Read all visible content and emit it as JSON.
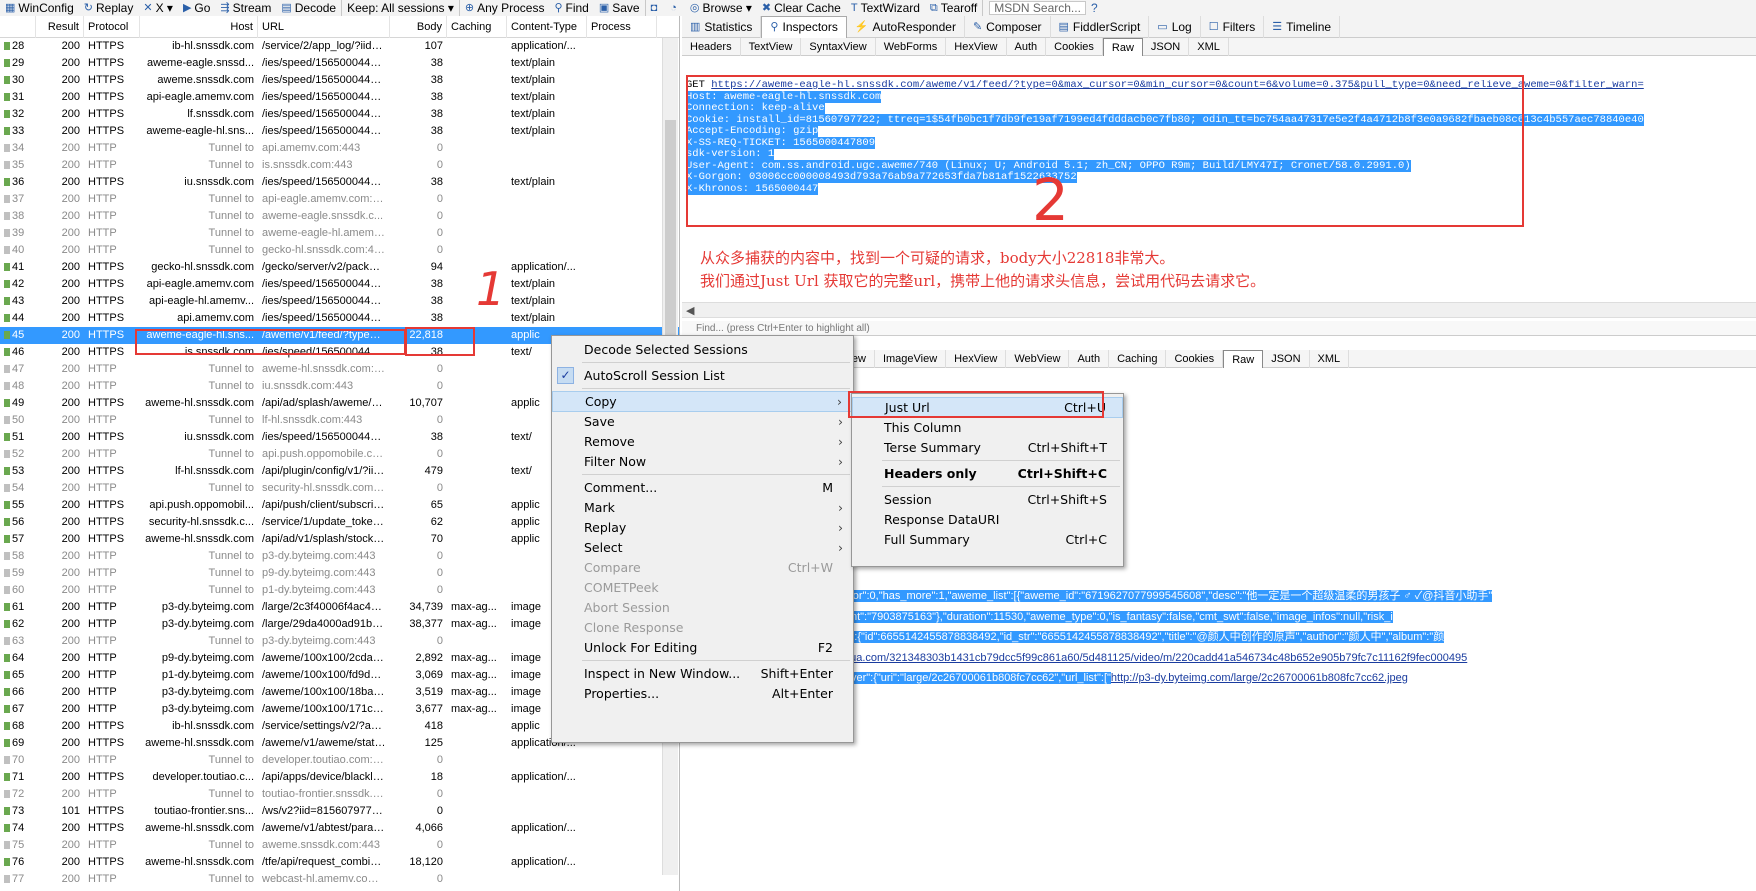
{
  "toolbar": {
    "items": [
      {
        "label": "WinConfig",
        "icon": "windows-icon"
      },
      {
        "label": "Replay",
        "icon": "replay-icon"
      },
      {
        "label": "X ▾",
        "icon": "remove-icon"
      },
      {
        "label": "Go",
        "icon": "go-arrow-icon"
      },
      {
        "label": "Stream",
        "icon": "stream-icon"
      },
      {
        "label": "Decode",
        "icon": "decode-icon"
      },
      {
        "label": "Keep: All sessions ▾",
        "icon": ""
      },
      {
        "label": "Any Process",
        "icon": "crosshair-icon"
      },
      {
        "label": "Find",
        "icon": "binoculars-icon"
      },
      {
        "label": "Save",
        "icon": "save-icon"
      },
      {
        "label": "",
        "icon": "camera-icon"
      },
      {
        "label": "",
        "icon": "timer-icon"
      },
      {
        "label": "Browse ▾",
        "icon": "browse-icon"
      },
      {
        "label": "Clear Cache",
        "icon": "clear-cache-icon"
      },
      {
        "label": "TextWizard",
        "icon": "textwizard-icon"
      },
      {
        "label": "Tearoff",
        "icon": "tearoff-icon"
      }
    ],
    "search_placeholder": "MSDN Search...",
    "help_icon": "help-icon"
  },
  "sessions": {
    "columns": [
      "",
      "Result",
      "Protocol",
      "Host",
      "URL",
      "Body",
      "Caching",
      "Content-Type",
      "Process"
    ],
    "rows": [
      [
        "28",
        "200",
        "HTTPS",
        "ib-hl.snssdk.com",
        "/service/2/app_log/?iid=8...",
        "107",
        "",
        "application/...",
        "",
        false,
        false
      ],
      [
        "29",
        "200",
        "HTTPS",
        "aweme-eagle.snssd...",
        "/ies/speed/1565000447552",
        "38",
        "",
        "text/plain",
        "",
        false,
        false
      ],
      [
        "30",
        "200",
        "HTTPS",
        "aweme.snssdk.com",
        "/ies/speed/1565000447563",
        "38",
        "",
        "text/plain",
        "",
        false,
        false
      ],
      [
        "31",
        "200",
        "HTTPS",
        "api-eagle.amemv.com",
        "/ies/speed/1565000447271",
        "38",
        "",
        "text/plain",
        "",
        false,
        false
      ],
      [
        "32",
        "200",
        "HTTPS",
        "lf.snssdk.com",
        "/ies/speed/1565000447564",
        "38",
        "",
        "text/plain",
        "",
        false,
        false
      ],
      [
        "33",
        "200",
        "HTTPS",
        "aweme-eagle-hl.sns...",
        "/ies/speed/1565000447554",
        "38",
        "",
        "text/plain",
        "",
        false,
        false
      ],
      [
        "34",
        "200",
        "HTTP",
        "Tunnel to",
        "api.amemv.com:443",
        "0",
        "",
        "",
        "",
        true,
        false
      ],
      [
        "35",
        "200",
        "HTTP",
        "Tunnel to",
        "is.snssdk.com:443",
        "0",
        "",
        "",
        "",
        true,
        false
      ],
      [
        "36",
        "200",
        "HTTPS",
        "iu.snssdk.com",
        "/ies/speed/1565000447599",
        "38",
        "",
        "text/plain",
        "",
        false,
        false
      ],
      [
        "37",
        "200",
        "HTTP",
        "Tunnel to",
        "api-eagle.amemv.com:443",
        "0",
        "",
        "",
        "",
        true,
        false
      ],
      [
        "38",
        "200",
        "HTTP",
        "Tunnel to",
        "aweme-eagle.snssdk.c...",
        "0",
        "",
        "",
        "",
        true,
        false
      ],
      [
        "39",
        "200",
        "HTTP",
        "Tunnel to",
        "aweme-eagle-hl.amemv.com:...",
        "0",
        "",
        "",
        "",
        true,
        false
      ],
      [
        "40",
        "200",
        "HTTP",
        "Tunnel to",
        "gecko-hl.snssdk.com:443",
        "0",
        "",
        "",
        "",
        true,
        false
      ],
      [
        "41",
        "200",
        "HTTPS",
        "gecko-hl.snssdk.com",
        "/gecko/server/v2/packag...",
        "94",
        "",
        "application/...",
        "",
        false,
        false
      ],
      [
        "42",
        "200",
        "HTTPS",
        "api-eagle.amemv.com",
        "/ies/speed/1565000447868",
        "38",
        "",
        "text/plain",
        "",
        false,
        false
      ],
      [
        "43",
        "200",
        "HTTPS",
        "api-eagle-hl.amemv...",
        "/ies/speed/1565000447891",
        "38",
        "",
        "text/plain",
        "",
        false,
        false
      ],
      [
        "44",
        "200",
        "HTTPS",
        "api.amemv.com",
        "/ies/speed/1565000447838",
        "38",
        "",
        "text/plain",
        "",
        false,
        false
      ],
      [
        "45",
        "200",
        "HTTPS",
        "aweme-eagle-hl.sns...",
        "/aweme/v1/feed/?type=0...",
        "22,818",
        "",
        "applic",
        "",
        false,
        true
      ],
      [
        "46",
        "200",
        "HTTPS",
        "is.snssdk.com",
        "/ies/speed/1565000447841",
        "38",
        "",
        "text/",
        "",
        false,
        false
      ],
      [
        "47",
        "200",
        "HTTP",
        "Tunnel to",
        "aweme-hl.snssdk.com:443",
        "0",
        "",
        "",
        "",
        true,
        false
      ],
      [
        "48",
        "200",
        "HTTP",
        "Tunnel to",
        "iu.snssdk.com:443",
        "0",
        "",
        "",
        "",
        true,
        false
      ],
      [
        "49",
        "200",
        "HTTPS",
        "aweme-hl.snssdk.com",
        "/api/ad/splash/aweme/v1...",
        "10,707",
        "",
        "applic",
        "",
        false,
        false
      ],
      [
        "50",
        "200",
        "HTTP",
        "Tunnel to",
        "lf-hl.snssdk.com:443",
        "0",
        "",
        "",
        "",
        true,
        false
      ],
      [
        "51",
        "200",
        "HTTPS",
        "iu.snssdk.com",
        "/ies/speed/1565000448102",
        "38",
        "",
        "text/",
        "",
        false,
        false
      ],
      [
        "52",
        "200",
        "HTTP",
        "Tunnel to",
        "api.push.oppomobile.com:...",
        "0",
        "",
        "",
        "",
        true,
        false
      ],
      [
        "53",
        "200",
        "HTTPS",
        "lf-hl.snssdk.com",
        "/api/plugin/config/v1/?iid=...",
        "479",
        "",
        "text/",
        "",
        false,
        false
      ],
      [
        "54",
        "200",
        "HTTP",
        "Tunnel to",
        "security-hl.snssdk.com:443",
        "0",
        "",
        "",
        "",
        true,
        false
      ],
      [
        "55",
        "200",
        "HTTPS",
        "api.push.oppomobil...",
        "/api/push/client/subscribe...",
        "65",
        "",
        "applic",
        "",
        false,
        false
      ],
      [
        "56",
        "200",
        "HTTPS",
        "security-hl.snssdk.c...",
        "/service/1/update_token/...",
        "62",
        "",
        "applic",
        "",
        false,
        false
      ],
      [
        "57",
        "200",
        "HTTPS",
        "aweme-hl.snssdk.com",
        "/api/ad/v1/splash/stock/?...",
        "70",
        "",
        "applic",
        "",
        false,
        false
      ],
      [
        "58",
        "200",
        "HTTP",
        "Tunnel to",
        "p3-dy.byteimg.com:443",
        "0",
        "",
        "",
        "",
        true,
        false
      ],
      [
        "59",
        "200",
        "HTTP",
        "Tunnel to",
        "p9-dy.byteimg.com:443",
        "0",
        "",
        "",
        "",
        true,
        false
      ],
      [
        "60",
        "200",
        "HTTP",
        "Tunnel to",
        "p1-dy.byteimg.com:443",
        "0",
        "",
        "",
        "",
        true,
        false
      ],
      [
        "61",
        "200",
        "HTTP",
        "p3-dy.byteimg.com",
        "/large/2c3f40006f4ac495...",
        "34,739",
        "max-ag...",
        "image",
        "",
        false,
        false
      ],
      [
        "62",
        "200",
        "HTTP",
        "p3-dy.byteimg.com",
        "/large/29da4000ad91b42...",
        "38,377",
        "max-ag...",
        "image",
        "",
        false,
        false
      ],
      [
        "63",
        "200",
        "HTTP",
        "Tunnel to",
        "p3-dy.byteimg.com:443",
        "0",
        "",
        "",
        "",
        true,
        false
      ],
      [
        "64",
        "200",
        "HTTP",
        "p9-dy.byteimg.com",
        "/aweme/100x100/2cdae0...",
        "2,892",
        "max-ag...",
        "image",
        "",
        false,
        false
      ],
      [
        "65",
        "200",
        "HTTP",
        "p1-dy.byteimg.com",
        "/aweme/100x100/fd9d00...",
        "3,069",
        "max-ag...",
        "image",
        "",
        false,
        false
      ],
      [
        "66",
        "200",
        "HTTP",
        "p3-dy.byteimg.com",
        "/aweme/100x100/18baf0...",
        "3,519",
        "max-ag...",
        "image",
        "",
        false,
        false
      ],
      [
        "67",
        "200",
        "HTTP",
        "p3-dy.byteimg.com",
        "/aweme/100x100/171c30...",
        "3,677",
        "max-ag...",
        "image",
        "",
        false,
        false
      ],
      [
        "68",
        "200",
        "HTTPS",
        "ib-hl.snssdk.com",
        "/service/settings/v2/?app...",
        "418",
        "",
        "applic",
        "",
        false,
        false
      ],
      [
        "69",
        "200",
        "HTTPS",
        "aweme-hl.snssdk.com",
        "/aweme/v1/aweme/stats/...",
        "125",
        "",
        "application/...",
        "",
        false,
        false
      ],
      [
        "70",
        "200",
        "HTTP",
        "Tunnel to",
        "developer.toutiao.com:443",
        "0",
        "",
        "",
        "",
        true,
        false
      ],
      [
        "71",
        "200",
        "HTTPS",
        "developer.toutiao.c...",
        "/api/apps/device/blacklist?...",
        "18",
        "",
        "application/...",
        "",
        false,
        false
      ],
      [
        "72",
        "200",
        "HTTP",
        "Tunnel to",
        "toutiao-frontier.snssdk.co...",
        "0",
        "",
        "",
        "",
        true,
        false
      ],
      [
        "73",
        "101",
        "HTTPS",
        "toutiao-frontier.sns...",
        "/ws/v2?iid=81560797722...",
        "0",
        "",
        "",
        "",
        false,
        false
      ],
      [
        "74",
        "200",
        "HTTPS",
        "aweme-hl.snssdk.com",
        "/aweme/v1/abtest/param...",
        "4,066",
        "",
        "application/...",
        "",
        false,
        false
      ],
      [
        "75",
        "200",
        "HTTP",
        "Tunnel to",
        "aweme.snssdk.com:443",
        "0",
        "",
        "",
        "",
        true,
        false
      ],
      [
        "76",
        "200",
        "HTTPS",
        "aweme-hl.snssdk.com",
        "/tfe/api/request_combine/...",
        "18,120",
        "",
        "application/...",
        "",
        false,
        false
      ],
      [
        "77",
        "200",
        "HTTP",
        "Tunnel to",
        "webcast-hl.amemv.com:443",
        "0",
        "",
        "",
        "",
        true,
        false
      ]
    ]
  },
  "right_tabs": [
    {
      "label": "Statistics",
      "icon": "statistics-icon"
    },
    {
      "label": "Inspectors",
      "icon": "inspectors-icon"
    },
    {
      "label": "AutoResponder",
      "icon": "autoresponder-icon"
    },
    {
      "label": "Composer",
      "icon": "composer-icon"
    },
    {
      "label": "FiddlerScript",
      "icon": "fiddlerscript-icon"
    },
    {
      "label": "Log",
      "icon": "log-icon"
    },
    {
      "label": "Filters",
      "icon": "filters-icon"
    },
    {
      "label": "Timeline",
      "icon": "timeline-icon"
    }
  ],
  "request_tabs": [
    "Headers",
    "TextView",
    "SyntaxView",
    "WebForms",
    "HexView",
    "Auth",
    "Cookies",
    "Raw",
    "JSON",
    "XML"
  ],
  "request_active_tab": "Raw",
  "request_raw": {
    "get_prefix": "GET ",
    "get_url": "https://aweme-eagle-hl.snssdk.com/aweme/v1/feed/?type=0&max_cursor=0&min_cursor=0&count=6&volume=0.375&pull_type=0&need_relieve_aweme=0&filter_warn=",
    "headers": [
      "Host: aweme-eagle-hl.snssdk.com",
      "Connection: keep-alive",
      "Cookie: install_id=81560797722; ttreq=1$54fb0bc1f7db9fe19af7199ed4fdddacb0c7fb80; odin_tt=bc754aa47317e5e2f4a4712b8f3e0a9682fbaeb08c613c4b557aec78840e40",
      "Accept-Encoding: gzip",
      "X-SS-REQ-TICKET: 1565000447809",
      "sdk-version: 1",
      "User-Agent: com.ss.android.ugc.aweme/740 (Linux; U; Android 5.1; zh_CN; OPPO R9m; Build/LMY47I; Cronet/58.0.2991.0)",
      "X-Gorgon: 03006cc000008493d793a76ab9a772653fda7b81af1522633752",
      "X-Khronos: 1565000447"
    ]
  },
  "annotation": {
    "number_two": "2",
    "number_one": "1",
    "lines": [
      "从众多捕获的内容中，找到一个可疑的请求，body大小22818非常大。",
      "我们通过Just Url 获取它的完整url，携带上他的请求头信息，尝试用代码去请求它。"
    ]
  },
  "find_placeholder": "Find... (press Ctrl+Enter to highlight all)",
  "response_tabs": [
    "View",
    "SyntaxView",
    "ImageView",
    "HexView",
    "WebView",
    "Auth",
    "Caching",
    "Cookies",
    "Raw",
    "JSON",
    "XML"
  ],
  "response_active_tab": "Raw",
  "response_lines": [
    {
      "text": "ursor\":0,\"max_cursor\":0,\"has_more\":1,\"aweme_list\":[{\"aweme_id\":\"6719627077999545608\",\"desc\":\"他一定是一个超级温柔的男孩子 ♂ ✓@抖音小助手\"",
      "link": ""
    },
    {
      "text": "ea\":true,\"view_count\":\"7903875163\"},\"duration\":11530,\"aweme_type\":0,\"is_fantasy\":false,\"cmt_swt\":false,\"image_infos\":null,\"risk_i",
      "link": ""
    },
    {
      "text": "unj78Xr0I\"},\"music\":{\"id\":6655142455878838492,\"id_str\":\"6655142455878838492\",\"title\":\"@颜人中创作的原声\",\"author\":\"颜人中\",\"album\":\"颜",
      "link": ""
    },
    {
      "text": "[\"",
      "link": "http://v9-dy-z.ixigua.com/321348303b1431cb79dcc5f99c861a60/5d481125/video/m/220cadd41a546734c48b652e905b79fc7c11162f9fec000495"
    },
    {
      "text": "\":360,\"dynamic_cover\":{\"uri\":\"large/2c26700061b808fc7cc62\",\"url_list\":[\"",
      "link": "http://p3-dy.byteimg.com/large/2c26700061b808fc7cc62.jpeg"
    }
  ],
  "context_menu": {
    "items": [
      {
        "label": "Decode Selected Sessions",
        "shortcut": "",
        "submenu": false,
        "disabled": false
      },
      {
        "sep": true
      },
      {
        "label": "AutoScroll Session List",
        "shortcut": "",
        "submenu": false,
        "disabled": false,
        "checked": true
      },
      {
        "sep": true
      },
      {
        "label": "Copy",
        "shortcut": "",
        "submenu": true,
        "disabled": false,
        "hover": true
      },
      {
        "label": "Save",
        "shortcut": "",
        "submenu": true,
        "disabled": false
      },
      {
        "label": "Remove",
        "shortcut": "",
        "submenu": true,
        "disabled": false
      },
      {
        "label": "Filter Now",
        "shortcut": "",
        "submenu": true,
        "disabled": false
      },
      {
        "sep": true
      },
      {
        "label": "Comment...",
        "shortcut": "M",
        "submenu": false,
        "disabled": false
      },
      {
        "label": "Mark",
        "shortcut": "",
        "submenu": true,
        "disabled": false
      },
      {
        "label": "Replay",
        "shortcut": "",
        "submenu": true,
        "disabled": false
      },
      {
        "label": "Select",
        "shortcut": "",
        "submenu": true,
        "disabled": false
      },
      {
        "label": "Compare",
        "shortcut": "Ctrl+W",
        "submenu": false,
        "disabled": true
      },
      {
        "label": "COMETPeek",
        "shortcut": "",
        "submenu": false,
        "disabled": true
      },
      {
        "label": "Abort Session",
        "shortcut": "",
        "submenu": false,
        "disabled": true
      },
      {
        "label": "Clone Response",
        "shortcut": "",
        "submenu": false,
        "disabled": true
      },
      {
        "label": "Unlock For Editing",
        "shortcut": "F2",
        "submenu": false,
        "disabled": false
      },
      {
        "sep": true
      },
      {
        "label": "Inspect in New Window...",
        "shortcut": "Shift+Enter",
        "submenu": false,
        "disabled": false
      },
      {
        "label": "Properties...",
        "shortcut": "Alt+Enter",
        "submenu": false,
        "disabled": false
      }
    ]
  },
  "copy_submenu": {
    "items": [
      {
        "label": "Just Url",
        "shortcut": "Ctrl+U",
        "hover": true
      },
      {
        "label": "This Column",
        "shortcut": ""
      },
      {
        "label": "Terse Summary",
        "shortcut": "Ctrl+Shift+T"
      },
      {
        "sep": true
      },
      {
        "label": "Headers only",
        "shortcut": "Ctrl+Shift+C",
        "bold": true
      },
      {
        "sep": true
      },
      {
        "label": "Session",
        "shortcut": "Ctrl+Shift+S"
      },
      {
        "label": "Response DataURI",
        "shortcut": ""
      },
      {
        "label": "Full Summary",
        "shortcut": "Ctrl+C"
      }
    ]
  },
  "colors": {
    "selection": "#3399ff",
    "annotation_red": "#e53935",
    "link_blue": "#1a3c9f"
  }
}
